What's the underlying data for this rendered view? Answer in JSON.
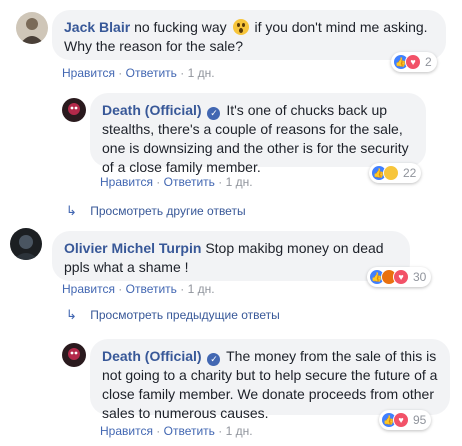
{
  "comments": {
    "jack": {
      "author": "Jack Blair",
      "text_before_emoji": "no fucking way",
      "text_after_emoji": "if you don't mind me asking. Why the reason for the sale?",
      "like": "Нравится",
      "reply": "Ответить",
      "time": "1 дн.",
      "reactions_count": "2"
    },
    "death1": {
      "author": "Death (Official)",
      "text": "It's one of chucks back up stealths, there's a couple of reasons for the sale, one is downsizing and the other is for the security of a close family member.",
      "like": "Нравится",
      "reply": "Ответить",
      "time": "1 дн.",
      "reactions_count": "22"
    },
    "other_replies": "Просмотреть другие ответы",
    "olivier": {
      "author": "Olivier Michel Turpin",
      "text": "Stop makibg money on dead ppls what a shame !",
      "like": "Нравится",
      "reply": "Ответить",
      "time": "1 дн.",
      "reactions_count": "30"
    },
    "prev_replies": "Просмотреть предыдущие ответы",
    "death2": {
      "author": "Death (Official)",
      "text": "The money from the sale of this is not going to a charity but to help secure the future of a close family member. We donate proceeds from other sales to numerous causes.",
      "like": "Нравится",
      "reply": "Ответить",
      "time": "1 дн.",
      "reactions_count": "95"
    }
  },
  "colors": {
    "author": "#385898",
    "link": "#4267b2",
    "bubble": "#f2f3f5",
    "meta": "#90949c"
  }
}
